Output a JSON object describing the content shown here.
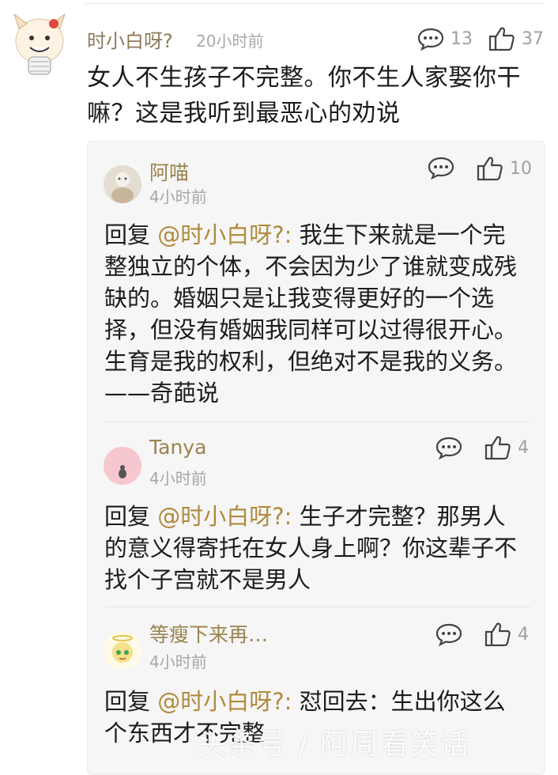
{
  "main_comment": {
    "author": "时小白呀?",
    "time": "20小时前",
    "comment_count": "13",
    "like_count": "37",
    "text": "女人不生孩子不完整。你不生人家娶你干嘛？这是我听到最恶心的劝说"
  },
  "replies": [
    {
      "author": "阿喵",
      "time": "4小时前",
      "like_count": "10",
      "prefix": "回复",
      "mention": "@时小白呀?:",
      "text": " 我生下来就是一个完整独立的个体，不会因为少了谁就变成残缺的。婚姻只是让我变得更好的一个选择，但没有婚姻我同样可以过得很开心。生育是我的权利，但绝对不是我的义务。——奇葩说"
    },
    {
      "author": "Tanya",
      "time": "4小时前",
      "like_count": "4",
      "prefix": "回复",
      "mention": "@时小白呀?:",
      "text": " 生子才完整？那男人的意义得寄托在女人身上啊？你这辈子不找个子宫就不是男人"
    },
    {
      "author": "等瘦下来再…",
      "time": "4小时前",
      "like_count": "4",
      "prefix": "回复",
      "mention": "@时小白呀?:",
      "text": " 怼回去：生出你这么个东西才不完整"
    }
  ],
  "watermark": "头条号 / 阿周看笑话",
  "colors": {
    "name": "#9b834f",
    "mention": "#b08a3d",
    "muted": "#a7a7a7",
    "reply_bg": "#f6f6f6"
  },
  "icons": [
    "comment-icon",
    "thumbs-up-icon"
  ]
}
